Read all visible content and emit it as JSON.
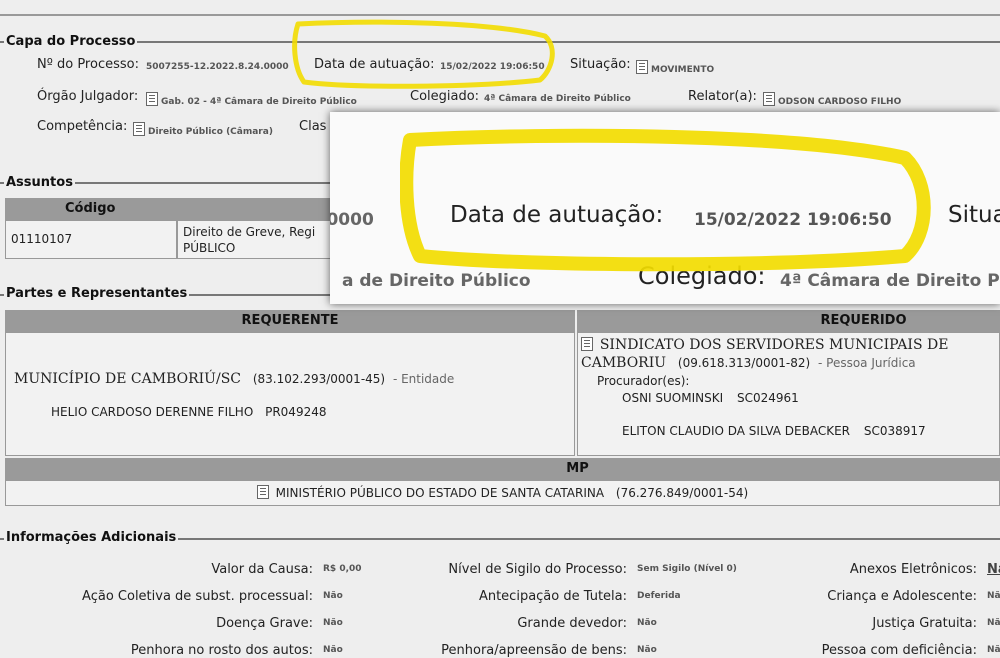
{
  "capa": {
    "legend": "Capa do Processo",
    "numero_label": "Nº do Processo:",
    "numero_value": "5007255-12.2022.8.24.0000",
    "data_label": "Data de autuação:",
    "data_value": "15/02/2022 19:06:50",
    "situacao_label": "Situação:",
    "situacao_value": "MOVIMENTO",
    "orgao_label": "Órgão Julgador:",
    "orgao_value": "Gab. 02 - 4ª Câmara de Direito Público",
    "colegiado_label": "Colegiado:",
    "colegiado_value": "4ª Câmara de Direito Público",
    "relator_label": "Relator(a):",
    "relator_value": "ODSON CARDOSO FILHO",
    "competencia_label": "Competência:",
    "competencia_value": "Direito Público (Câmara)",
    "classe_label": "Clas"
  },
  "assuntos": {
    "legend": "Assuntos",
    "header_codigo": "Código",
    "row_codigo": "01110107",
    "row_desc_1": "Direito de Greve, Regi",
    "row_desc_2": "PÚBLICO"
  },
  "partes": {
    "legend": "Partes e Representantes",
    "requerente_header": "REQUERENTE",
    "requerido_header": "REQUERIDO",
    "requerente_name": "MUNICÍPIO DE CAMBORIÚ/SC",
    "requerente_doc": "(83.102.293/0001-45)",
    "requerente_type": "- Entidade",
    "requerente_lawyer": "HELIO CARDOSO DERENNE FILHO",
    "requerente_oab": "PR049248",
    "requerido_name_1": "SINDICATO DOS SERVIDORES MUNICIPAIS DE",
    "requerido_name_2": "CAMBORIU",
    "requerido_doc": "(09.618.313/0001-82)",
    "requerido_type": "- Pessoa Jurídica",
    "procuradores_label": "Procurador(es):",
    "proc1_name": "OSNI SUOMINSKI",
    "proc1_oab": "SC024961",
    "proc2_name": "ELITON CLAUDIO DA SILVA DEBACKER",
    "proc2_oab": "SC038917",
    "mp_header": "MP",
    "mp_name": "MINISTÉRIO PÚBLICO DO ESTADO DE SANTA CATARINA",
    "mp_doc": "(76.276.849/0001-54)"
  },
  "info": {
    "legend": "Informações Adicionais",
    "valor_label": "Valor da Causa:",
    "valor_value": "R$ 0,00",
    "sigilo_label": "Nível de Sigilo do Processo:",
    "sigilo_value": "Sem Sigilo (Nível 0)",
    "anexos_label": "Anexos Eletrônicos:",
    "anexos_value": "Nã",
    "acao_label": "Ação Coletiva de subst. processual:",
    "acao_value": "Não",
    "tutela_label": "Antecipação de Tutela:",
    "tutela_value": "Deferida",
    "crianca_label": "Criança e Adolescente:",
    "crianca_value": "Nã",
    "doenca_label": "Doença Grave:",
    "doenca_value": "Não",
    "devedor_label": "Grande devedor:",
    "devedor_value": "Não",
    "justica_label": "Justiça Gratuita:",
    "justica_value": "Nã",
    "penhora_label": "Penhora no rosto dos autos:",
    "penhora_value": "Não",
    "penhora2_label": "Penhora/apreensão de bens:",
    "penhora2_value": "Não",
    "deficiencia_label": "Pessoa com deficiência:",
    "deficiencia_value": "Nã"
  },
  "colors": {
    "highlight": "#f2dc00",
    "header_grey": "#9a9a9a",
    "background": "#eeeeee"
  }
}
